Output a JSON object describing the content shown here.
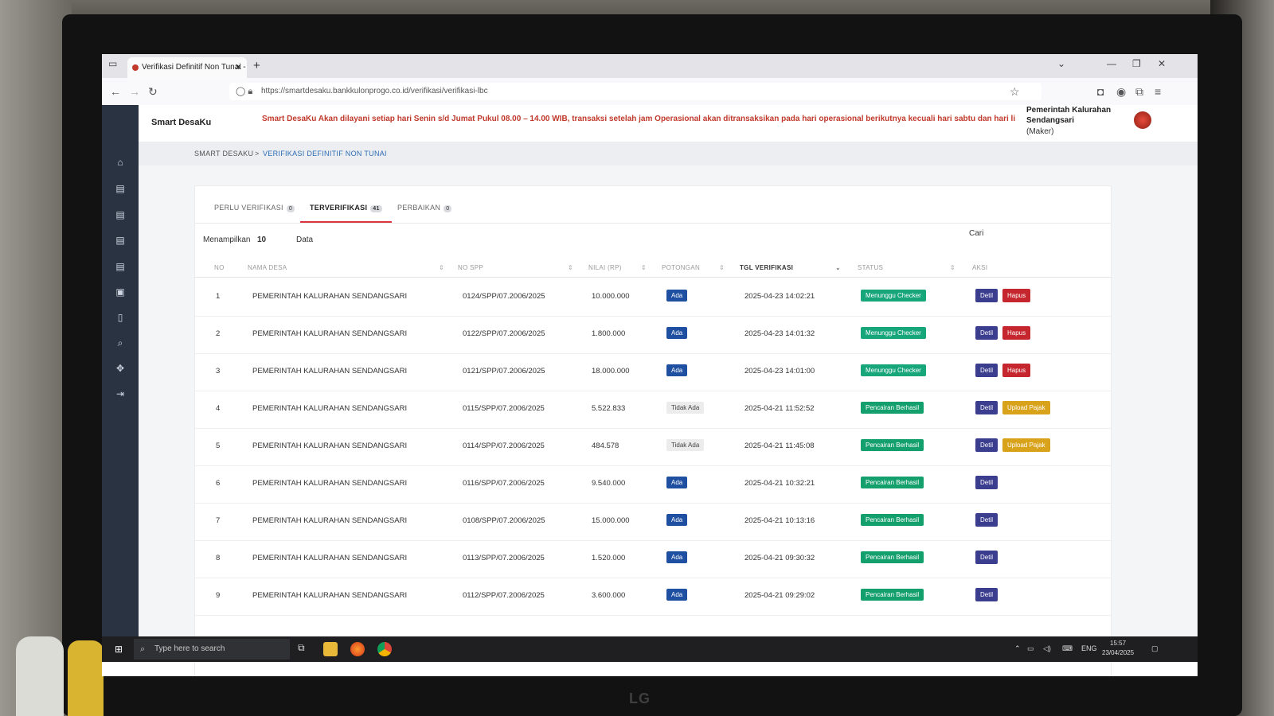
{
  "browser": {
    "tab_title": "Verifikasi Definitif Non Tunai - S",
    "url": "https://smartdesaku.bankkulonprogo.co.id/verifikasi/verifikasi-lbc"
  },
  "app": {
    "brand": "Smart DesaKu",
    "announcement": "Smart DesaKu Akan dilayani setiap hari Senin s/d Jumat Pukul 08.00 – 14.00 WIB, transaksi setelah jam Operasional akan ditransaksikan pada hari operasional berikutnya kecuali hari sabtu dan hari li",
    "user_name": "Pemerintah Kalurahan Sendangsari",
    "user_role": "(Maker)"
  },
  "breadcrumb": {
    "home": "SMART DESAKU",
    "separator": ">",
    "current": "VERIFIKASI DEFINITIF NON TUNAI"
  },
  "tabs": [
    {
      "label": "PERLU VERIFIKASI",
      "count": "0"
    },
    {
      "label": "TERVERIFIKASI",
      "count": "41"
    },
    {
      "label": "PERBAIKAN",
      "count": "0"
    }
  ],
  "controls": {
    "show_label": "Menampilkan",
    "show_value": "10",
    "show_suffix": "Data",
    "search_label": "Cari"
  },
  "columns": {
    "no": "NO",
    "nama_desa": "NAMA DESA",
    "no_spp": "NO SPP",
    "nilai": "NILAI (RP)",
    "potongan": "POTONGAN",
    "tgl": "TGL VERIFIKASI",
    "status": "STATUS",
    "aksi": "AKSI"
  },
  "buttons": {
    "detil": "Detil",
    "hapus": "Hapus",
    "upload": "Upload Pajak"
  },
  "status_colors": {
    "Menunggu Checker": "#17a57a",
    "Pencairan Berhasil": "#14a06d"
  },
  "rows": [
    {
      "no": "1",
      "nama": "PEMERINTAH KALURAHAN SENDANGSARI",
      "spp": "0124/SPP/07.2006/2025",
      "nilai": "10.000.000",
      "potongan": "Ada",
      "tgl": "2025-04-23 14:02:21",
      "status": "Menunggu Checker",
      "aksi": "hapus"
    },
    {
      "no": "2",
      "nama": "PEMERINTAH KALURAHAN SENDANGSARI",
      "spp": "0122/SPP/07.2006/2025",
      "nilai": "1.800.000",
      "potongan": "Ada",
      "tgl": "2025-04-23 14:01:32",
      "status": "Menunggu Checker",
      "aksi": "hapus"
    },
    {
      "no": "3",
      "nama": "PEMERINTAH KALURAHAN SENDANGSARI",
      "spp": "0121/SPP/07.2006/2025",
      "nilai": "18.000.000",
      "potongan": "Ada",
      "tgl": "2025-04-23 14:01:00",
      "status": "Menunggu Checker",
      "aksi": "hapus"
    },
    {
      "no": "4",
      "nama": "PEMERINTAH KALURAHAN SENDANGSARI",
      "spp": "0115/SPP/07.2006/2025",
      "nilai": "5.522.833",
      "potongan": "Tidak Ada",
      "tgl": "2025-04-21 11:52:52",
      "status": "Pencairan Berhasil",
      "aksi": "upload"
    },
    {
      "no": "5",
      "nama": "PEMERINTAH KALURAHAN SENDANGSARI",
      "spp": "0114/SPP/07.2006/2025",
      "nilai": "484.578",
      "potongan": "Tidak Ada",
      "tgl": "2025-04-21 11:45:08",
      "status": "Pencairan Berhasil",
      "aksi": "upload"
    },
    {
      "no": "6",
      "nama": "PEMERINTAH KALURAHAN SENDANGSARI",
      "spp": "0116/SPP/07.2006/2025",
      "nilai": "9.540.000",
      "potongan": "Ada",
      "tgl": "2025-04-21 10:32:21",
      "status": "Pencairan Berhasil",
      "aksi": "none"
    },
    {
      "no": "7",
      "nama": "PEMERINTAH KALURAHAN SENDANGSARI",
      "spp": "0108/SPP/07.2006/2025",
      "nilai": "15.000.000",
      "potongan": "Ada",
      "tgl": "2025-04-21 10:13:16",
      "status": "Pencairan Berhasil",
      "aksi": "none"
    },
    {
      "no": "8",
      "nama": "PEMERINTAH KALURAHAN SENDANGSARI",
      "spp": "0113/SPP/07.2006/2025",
      "nilai": "1.520.000",
      "potongan": "Ada",
      "tgl": "2025-04-21 09:30:32",
      "status": "Pencairan Berhasil",
      "aksi": "none"
    },
    {
      "no": "9",
      "nama": "PEMERINTAH KALURAHAN SENDANGSARI",
      "spp": "0112/SPP/07.2006/2025",
      "nilai": "3.600.000",
      "potongan": "Ada",
      "tgl": "2025-04-21 09:29:02",
      "status": "Pencairan Berhasil",
      "aksi": "none"
    }
  ],
  "taskbar": {
    "search_placeholder": "Type here to search",
    "lang": "ENG",
    "time": "15:57",
    "date": "23/04/2025"
  },
  "monitor_brand": "LG"
}
